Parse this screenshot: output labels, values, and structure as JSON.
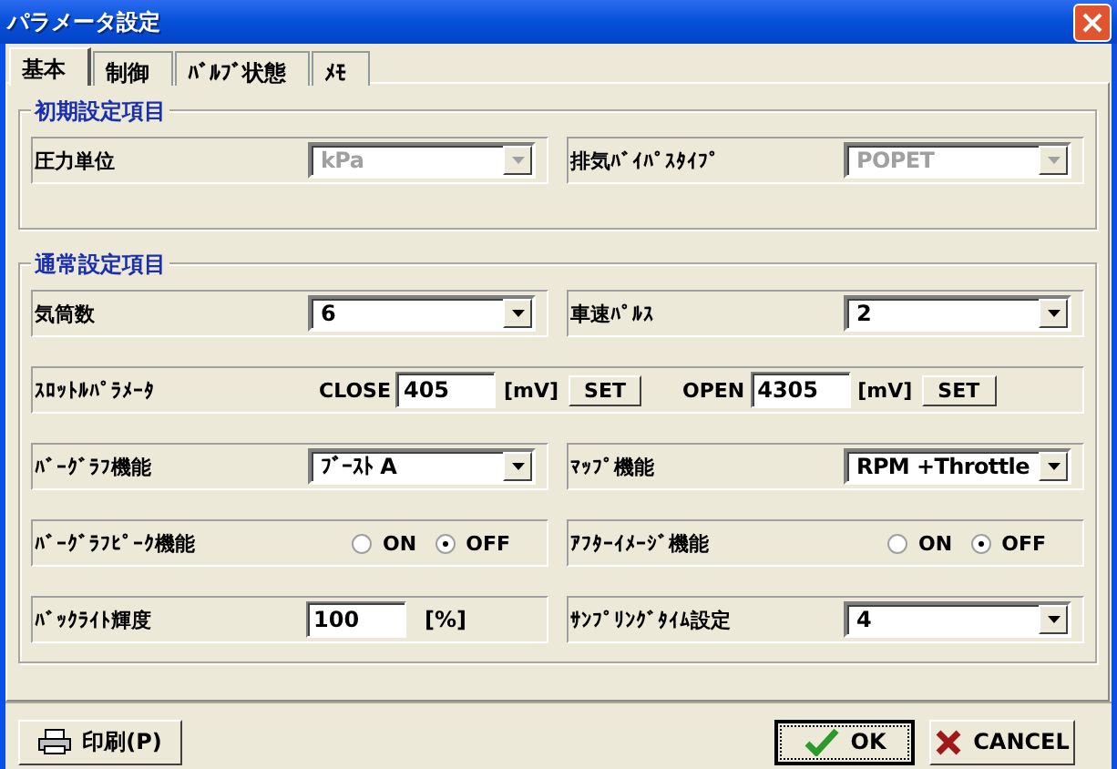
{
  "window": {
    "title": "パラメータ設定"
  },
  "tabs": [
    {
      "label": "基本",
      "selected": true
    },
    {
      "label": "制御",
      "selected": false
    },
    {
      "label": "ﾊﾞﾙﾌﾞ状態",
      "selected": false
    },
    {
      "label": "ﾒﾓ",
      "selected": false
    }
  ],
  "groups": [
    {
      "title": "初期設定項目",
      "rows": [
        {
          "kind": "split",
          "cells": [
            {
              "label": "圧力単位",
              "control": {
                "kind": "select",
                "value": "kPa",
                "disabled": true
              }
            },
            {
              "label": "排気ﾊﾞｲﾊﾟｽﾀｲﾌﾟ",
              "control": {
                "kind": "select",
                "value": "POPET",
                "disabled": true
              }
            }
          ]
        }
      ]
    },
    {
      "title": "通常設定項目",
      "rows": [
        {
          "kind": "split",
          "cells": [
            {
              "label": "気筒数",
              "control": {
                "kind": "select",
                "value": "6",
                "disabled": false
              }
            },
            {
              "label": "車速ﾊﾟﾙｽ",
              "control": {
                "kind": "select",
                "value": "2",
                "disabled": false
              }
            }
          ]
        },
        {
          "kind": "wide",
          "label": "ｽﾛｯﾄﾙﾊﾟﾗﾒｰﾀ",
          "parts": [
            {
              "kind": "caption",
              "text": "CLOSE"
            },
            {
              "kind": "input",
              "value": "405"
            },
            {
              "kind": "unit",
              "text": "[mV]"
            },
            {
              "kind": "button",
              "text": "SET"
            },
            {
              "kind": "caption",
              "text": "OPEN"
            },
            {
              "kind": "input",
              "value": "4305"
            },
            {
              "kind": "unit",
              "text": "[mV]"
            },
            {
              "kind": "button",
              "text": "SET"
            }
          ]
        },
        {
          "kind": "split",
          "cells": [
            {
              "label": "ﾊﾞｰｸﾞﾗﾌ機能",
              "control": {
                "kind": "select",
                "value": "ﾌﾞｰｽﾄ A",
                "disabled": false
              }
            },
            {
              "label": "ﾏｯﾌﾟ機能",
              "control": {
                "kind": "select",
                "value": "RPM +Throttle",
                "disabled": false
              }
            }
          ]
        },
        {
          "kind": "split",
          "cells": [
            {
              "label": "ﾊﾞｰｸﾞﾗﾌﾋﾟｰｸ機能",
              "control": {
                "kind": "radio",
                "options": [
                  {
                    "label": "ON",
                    "selected": false
                  },
                  {
                    "label": "OFF",
                    "selected": true
                  }
                ]
              }
            },
            {
              "label": "ｱﾌﾀｰｲﾒｰｼﾞ機能",
              "control": {
                "kind": "radio",
                "options": [
                  {
                    "label": "ON",
                    "selected": false
                  },
                  {
                    "label": "OFF",
                    "selected": true
                  }
                ]
              }
            }
          ]
        },
        {
          "kind": "split",
          "cells": [
            {
              "label": "ﾊﾞｯｸﾗｲﾄ輝度",
              "control": {
                "kind": "number",
                "value": "100",
                "unit": "[%]"
              }
            },
            {
              "label": "ｻﾝﾌﾟﾘﾝｸﾞﾀｲﾑ設定",
              "control": {
                "kind": "select",
                "value": "4",
                "disabled": false
              }
            }
          ]
        }
      ]
    }
  ],
  "buttons": [
    {
      "kind": "print",
      "label": "印刷(P)",
      "focused": false
    },
    {
      "kind": "ok",
      "label": "OK",
      "focused": true
    },
    {
      "kind": "cancel",
      "label": "CANCEL",
      "focused": false
    }
  ]
}
